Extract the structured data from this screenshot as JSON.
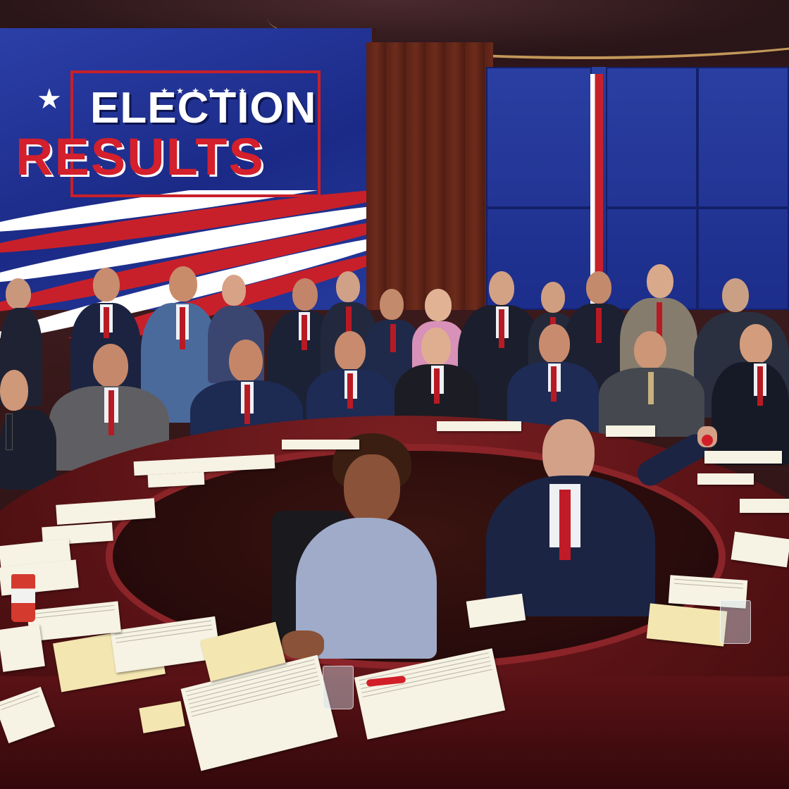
{
  "screen": {
    "headline_top": "ELECTION",
    "headline_bottom": "RESULTS",
    "stars": "★ ★ ★ ★ ★ ★"
  },
  "colors": {
    "screen_blue": "#1f2f94",
    "headline_red": "#d41f2c",
    "desk_mahogany": "#5e1417",
    "accent_gold": "#e8b86a"
  }
}
